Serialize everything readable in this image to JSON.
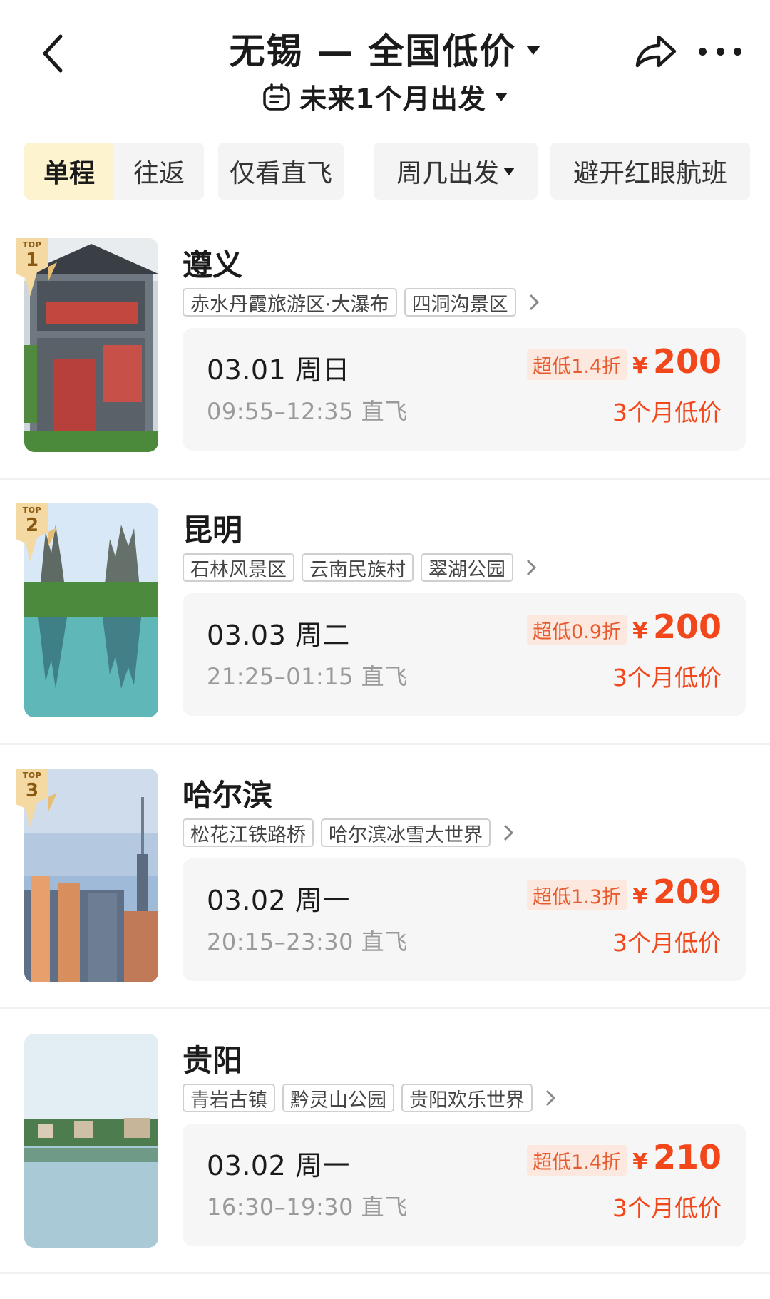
{
  "header": {
    "title": "无锡 — 全国低价",
    "subtitle": "未来1个月出发",
    "icons": [
      "back-icon",
      "calendar-icon",
      "share-icon",
      "more-icon"
    ]
  },
  "filters": {
    "segment": [
      "单程",
      "往返"
    ],
    "active_segment": "单程",
    "chips": [
      "仅看直飞",
      "周几出发",
      "避开红眼航班"
    ]
  },
  "colors": {
    "accent_price": "#f2471b",
    "active_tab_bg": "#fdf3cf",
    "discount_bg": "#fde8e0"
  },
  "destinations": [
    {
      "rank_label": "TOP",
      "rank": "1",
      "city": "遵义",
      "tags": [
        "赤水丹霞旅游区·大瀑布",
        "四洞沟景区"
      ],
      "date": "03.01 周日",
      "time": "09:55–12:35 直飞",
      "discount": "超低1.4折",
      "currency": "¥",
      "price": "200",
      "note": "3个月低价"
    },
    {
      "rank_label": "TOP",
      "rank": "2",
      "city": "昆明",
      "tags": [
        "石林风景区",
        "云南民族村",
        "翠湖公园"
      ],
      "date": "03.03 周二",
      "time": "21:25–01:15 直飞",
      "discount": "超低0.9折",
      "currency": "¥",
      "price": "200",
      "note": "3个月低价"
    },
    {
      "rank_label": "TOP",
      "rank": "3",
      "city": "哈尔滨",
      "tags": [
        "松花江铁路桥",
        "哈尔滨冰雪大世界"
      ],
      "date": "03.02 周一",
      "time": "20:15–23:30 直飞",
      "discount": "超低1.3折",
      "currency": "¥",
      "price": "209",
      "note": "3个月低价"
    },
    {
      "city": "贵阳",
      "tags": [
        "青岩古镇",
        "黔灵山公园",
        "贵阳欢乐世界"
      ],
      "date": "03.02 周一",
      "time": "16:30–19:30 直飞",
      "discount": "超低1.4折",
      "currency": "¥",
      "price": "210",
      "note": "3个月低价"
    }
  ]
}
